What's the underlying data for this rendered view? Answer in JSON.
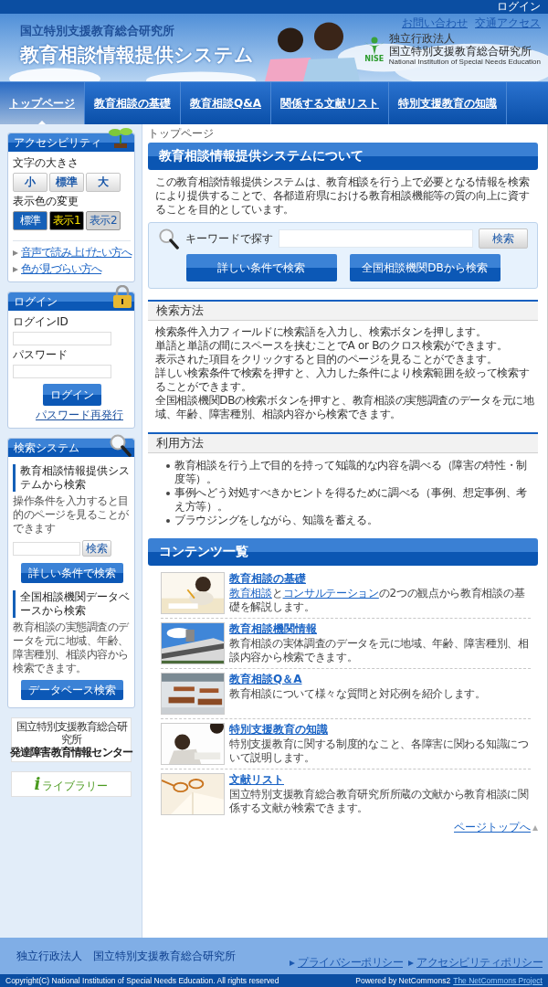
{
  "top_bar": {
    "login_link": "ログイン"
  },
  "header": {
    "org": "国立特別支援教育総合研究所",
    "title": "教育相談情報提供システム",
    "links": [
      "お問い合わせ",
      "交通アクセス"
    ],
    "logo": {
      "mark": "NISE",
      "small": "独立行政法人",
      "name": "国立特別支援教育総合研究所",
      "english": "National Institution of Special Needs Education"
    }
  },
  "nav": [
    {
      "label": "トップページ",
      "selected": true
    },
    {
      "label": "教育相談の基礎",
      "selected": false
    },
    {
      "label": "教育相談Q&A",
      "selected": false
    },
    {
      "label": "関係する文献リスト",
      "selected": false
    },
    {
      "label": "特別支援教育の知識",
      "selected": false
    }
  ],
  "sidebar": {
    "accessibility": {
      "title": "アクセシビリティ",
      "font_size_label": "文字の大きさ",
      "font_sizes": [
        "小",
        "標準",
        "大"
      ],
      "color_label": "表示色の変更",
      "color_modes": [
        {
          "label": "標準",
          "kind": "standard"
        },
        {
          "label": "表示1",
          "kind": "dark"
        },
        {
          "label": "表示2",
          "kind": "gray"
        }
      ],
      "links": [
        "音声で読み上げたい方へ",
        "色が見づらい方へ"
      ]
    },
    "login": {
      "title": "ログイン",
      "id_label": "ログインID",
      "password_label": "パスワード",
      "button": "ログイン",
      "reissue_link": "パスワード再発行"
    },
    "search": {
      "title": "検索システム",
      "sections": [
        {
          "heading": "教育相談情報提供システムから検索",
          "description": "操作条件を入力すると目的のページを見ることができます",
          "search_button": "検索",
          "button": "詳しい条件で検索"
        },
        {
          "heading": "全国相談機関データベースから検索",
          "description": "教育相談の実態調査のデータを元に地域、年齢、障害種別、相談内容から検索できます。",
          "button": "データベース検索"
        }
      ]
    },
    "banners": [
      {
        "small": "国立特別支援教育総合研究所",
        "name": "発達障害教育情報センター"
      },
      {
        "mark": "i",
        "name": "ライブラリー"
      }
    ]
  },
  "breadcrumb": "トップページ",
  "about": {
    "title": "教育相談情報提供システムについて",
    "intro": "この教育相談情報提供システムは、教育相談を行う上で必要となる情報を検索により提供することで、各都道府県における教育相談機能等の質の向上に資することを目的としています。"
  },
  "keyword_search": {
    "label": "キーワードで探す",
    "button": "検索",
    "buttons": [
      "詳しい条件で検索",
      "全国相談機関DBから検索"
    ]
  },
  "search_method": {
    "title": "検索方法",
    "lines": [
      "検索条件入力フィールドに検索語を入力し、検索ボタンを押します。",
      "単語と単語の間にスペースを挟むことでA or Bのクロス検索ができます。",
      "表示された項目をクリックすると目的のページを見ることができます。",
      "詳しい検索条件で検索を押すと、入力した条件により検索範囲を絞って検索することができます。",
      "全国相談機関DBの検索ボタンを押すと、教育相談の実態調査のデータを元に地域、年齢、障害種別、相談内容から検索できます。"
    ]
  },
  "usage": {
    "title": "利用方法",
    "items": [
      "教育相談を行う上で目的を持って知識的な内容を調べる（障害の特性・制度等）。",
      "事例へどう対処すべきかヒントを得るために調べる（事例、想定事例、考え方等）。",
      "ブラウジングをしながら、知識を蓄える。"
    ]
  },
  "contents": {
    "title": "コンテンツ一覧",
    "items": [
      {
        "title": "教育相談の基礎",
        "description": [
          {
            "kind": "link",
            "text": "教育相談"
          },
          {
            "kind": "text",
            "text": "と"
          },
          {
            "kind": "link",
            "text": "コンサルテーション"
          },
          {
            "kind": "text",
            "text": "の2つの観点から教育相談の基礎を解説します。"
          }
        ]
      },
      {
        "title": "教育相談機関情報",
        "description": [
          {
            "kind": "text",
            "text": "教育相談の実体調査のデータを元に地域、年齢、障害種別、相談内容から検索できます。"
          }
        ]
      },
      {
        "title": "教育相談Q＆A",
        "description": [
          {
            "kind": "text",
            "text": "教育相談について様々な質問と対応例を紹介します。"
          }
        ]
      },
      {
        "title": "特別支援教育の知識",
        "description": [
          {
            "kind": "text",
            "text": "特別支援教育に関する制度的なこと、各障害に関わる知識について説明します。"
          }
        ]
      },
      {
        "title": "文献リスト",
        "description": [
          {
            "kind": "text",
            "text": "国立特別支援教育総合教育研究所所蔵の文献から教育相談に関係する文献が検索できます。"
          }
        ]
      }
    ]
  },
  "page_top_link": "ページトップへ",
  "footer": {
    "org": "独立行政法人　国立特別支援教育総合研究所",
    "links": [
      "プライバシーポリシー",
      "アクセシビリティポリシー"
    ],
    "copyright": "Copyright(C) National Institution of Special Needs Education. All rights reserved",
    "powered": "Powered by NetCommons2",
    "project_link": "The NetCommons Project"
  }
}
